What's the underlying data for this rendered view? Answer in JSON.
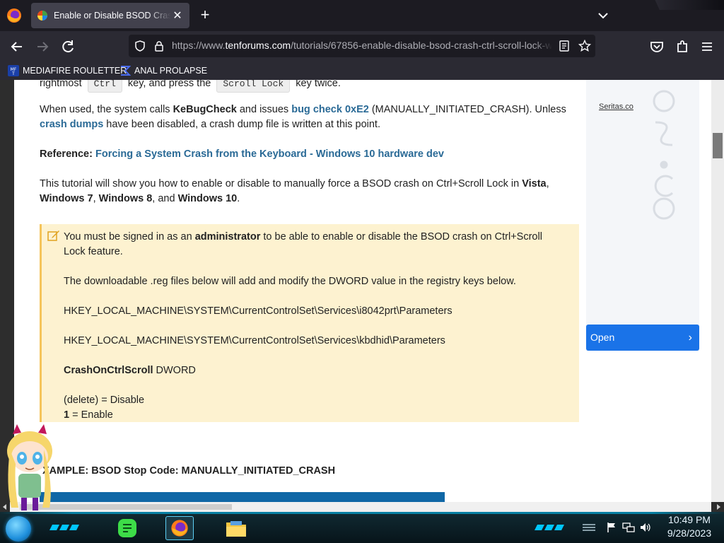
{
  "browser": {
    "tab_title": "Enable or Disable BSOD Crash on Ctrl+Scroll Lock",
    "new_tab_symbol": "+",
    "close_symbol": "✕",
    "url_prefix": "https://www.",
    "url_host": "tenforums.com",
    "url_path": "/tutorials/67856-enable-disable-bsod-crash-ctrl-scroll-lock-w",
    "bookmarks": [
      {
        "label": "MEDIAFIRE ROULETTER",
        "icon": "mediafire-icon"
      },
      {
        "label": "ANAL PROLAPSE",
        "icon": "bookmark-sigma-icon"
      }
    ]
  },
  "article": {
    "line1_start": "rightmost",
    "kbd_ctrl": "Ctrl",
    "line1_mid": "key, and press the",
    "kbd_scroll": "Scroll Lock",
    "line1_end": "key twice.",
    "p2_a": "When used, the system calls ",
    "p2_kebug": "KeBugCheck",
    "p2_b": " and issues ",
    "p2_link1": "bug check 0xE2",
    "p2_c": " (MANUALLY_INITIATED_CRASH). Unless ",
    "p2_link2a": "crash",
    "p2_link2b": "dumps",
    "p2_d": " have been disabled, a crash dump file is written at this point.",
    "ref_label": "Reference:",
    "ref_link": "Forcing a System Crash from the Keyboard - Windows 10 hardware dev",
    "p4_a": "This tutorial will show you how to enable or disable to manually force a BSOD crash on Ctrl+Scroll Lock in ",
    "p4_vista": "Vista",
    "p4_comma": ",",
    "p4_w7": "Windows 7",
    "p4_sep1": ", ",
    "p4_w8": "Windows 8",
    "p4_and": ", and ",
    "p4_w10": "Windows 10",
    "p4_end": "."
  },
  "note": {
    "n1_a": "You must be signed in as an ",
    "n1_admin": "administrator",
    "n1_b": " to be able to enable or disable the BSOD crash on Ctrl+Scroll Lock feature.",
    "n2": "The downloadable .reg files below will add and modify the DWORD value in the registry keys below.",
    "key1": "HKEY_LOCAL_MACHINE\\SYSTEM\\CurrentControlSet\\Services\\i8042prt\\Parameters",
    "key2": "HKEY_LOCAL_MACHINE\\SYSTEM\\CurrentControlSet\\Services\\kbdhid\\Parameters",
    "value_name": "CrashOnCtrlScroll",
    "value_type": " DWORD",
    "opt1": "(delete) = Disable",
    "opt2_num": "1",
    "opt2_rest": " = Enable"
  },
  "example_heading": "XAMPLE: BSOD Stop Code: MANUALLY_INITIATED_CRASH",
  "ad": {
    "label": "Seritas.co",
    "button": "Open",
    "chevron": "›"
  },
  "taskbar": {
    "time": "10:49 PM",
    "date": "9/28/2023"
  },
  "colors": {
    "link": "#2a6a96",
    "note_bg": "#fdf2d0",
    "note_border": "#f5c45b",
    "ad_button": "#1a73e8"
  }
}
